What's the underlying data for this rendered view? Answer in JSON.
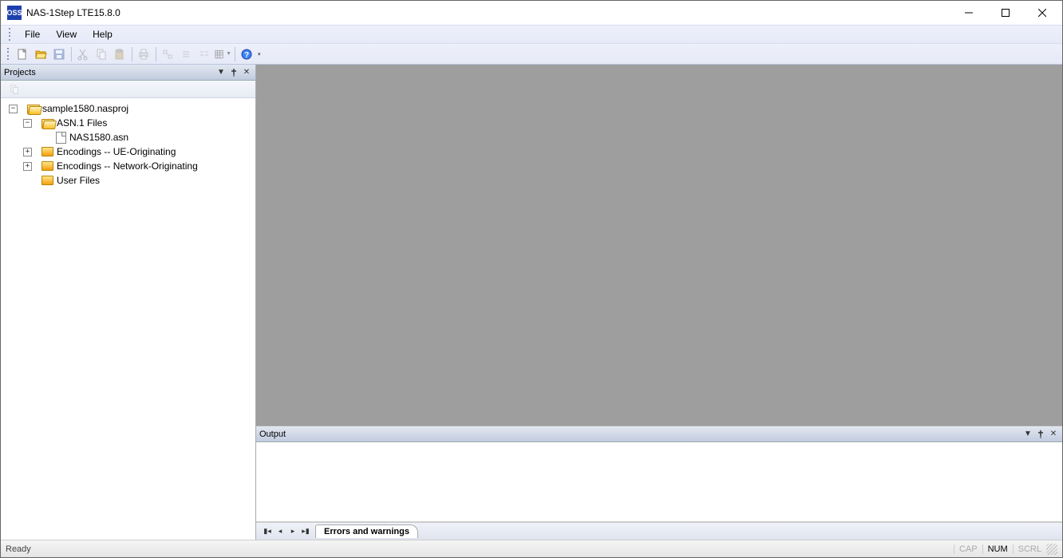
{
  "window": {
    "title": "NAS-1Step LTE15.8.0",
    "icon_text": "OSS"
  },
  "menu": {
    "items": [
      "File",
      "View",
      "Help"
    ]
  },
  "panels": {
    "projects": {
      "title": "Projects",
      "tree": [
        {
          "label": "sample1580.nasproj",
          "indent": 0,
          "expander": "minus",
          "icon": "folder-open"
        },
        {
          "label": "ASN.1 Files",
          "indent": 1,
          "expander": "minus",
          "icon": "folder-open"
        },
        {
          "label": "NAS1580.asn",
          "indent": 2,
          "expander": "blank",
          "icon": "file"
        },
        {
          "label": "Encodings -- UE-Originating",
          "indent": 1,
          "expander": "plus",
          "icon": "folder-closed"
        },
        {
          "label": "Encodings -- Network-Originating",
          "indent": 1,
          "expander": "plus",
          "icon": "folder-closed"
        },
        {
          "label": "User Files",
          "indent": 1,
          "expander": "blank",
          "icon": "folder-closed"
        }
      ]
    },
    "output": {
      "title": "Output",
      "tab": "Errors and warnings"
    }
  },
  "status": {
    "text": "Ready",
    "cap": "CAP",
    "num": "NUM",
    "scrl": "SCRL"
  }
}
